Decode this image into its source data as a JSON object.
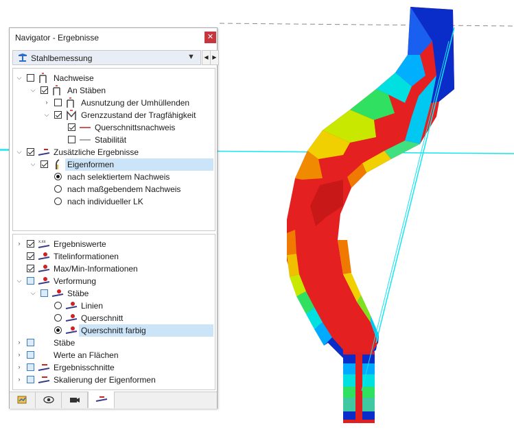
{
  "panel": {
    "title": "Navigator - Ergebnisse",
    "close_icon": "close-icon",
    "combo_value": "Stahlbemessung",
    "combo_icon": "steel-design-icon"
  },
  "tree_top": [
    {
      "label": "Nachweise",
      "checked": false,
      "expanded": true,
      "icon": "design-check-icon"
    },
    {
      "label": "An Stäben",
      "checked": true,
      "expanded": true,
      "icon": "design-check-icon"
    },
    {
      "label": "Ausnutzung der Umhüllenden",
      "checked": false,
      "expanded": false,
      "icon": "design-check-icon"
    },
    {
      "label": "Grenzzustand der Tragfähigkeit",
      "checked": true,
      "expanded": true,
      "icon": "ultimate-limit-state-icon"
    },
    {
      "label": "Querschnittsnachweis",
      "checked": true,
      "icon": "red-line-icon"
    },
    {
      "label": "Stabilität",
      "checked": false,
      "icon": "gray-line-icon"
    },
    {
      "label": "Zusätzliche Ergebnisse",
      "checked": true,
      "expanded": true,
      "icon": "additional-results-icon"
    },
    {
      "label": "Eigenformen",
      "checked": true,
      "expanded": true,
      "icon": "mode-shape-icon",
      "selected": true
    },
    {
      "label": "nach selektiertem Nachweis",
      "radio": true,
      "on": true
    },
    {
      "label": "nach maßgebendem Nachweis",
      "radio": true,
      "on": false
    },
    {
      "label": "nach individueller LK",
      "radio": true,
      "on": false
    }
  ],
  "tree_bottom": [
    {
      "label": "Ergebniswerte",
      "checked": true,
      "expanded": false,
      "icon": "result-values-icon"
    },
    {
      "label": "Titelinformationen",
      "checked": true,
      "icon": "title-info-icon"
    },
    {
      "label": "Max/Min-Informationen",
      "checked": true,
      "icon": "maxmin-info-icon"
    },
    {
      "label": "Verformung",
      "checked": false,
      "expanded": true,
      "icon": "deformation-icon",
      "blue": true
    },
    {
      "label": "Stäbe",
      "checked": false,
      "expanded": true,
      "icon": "members-icon",
      "blue": true
    },
    {
      "label": "Linien",
      "radio": true,
      "on": false,
      "icon": "members-icon"
    },
    {
      "label": "Querschnitt",
      "radio": true,
      "on": false,
      "icon": "members-icon"
    },
    {
      "label": "Querschnitt farbig",
      "radio": true,
      "on": true,
      "icon": "members-icon",
      "selected": true
    },
    {
      "label": "Stäbe",
      "checked": false,
      "expanded": false,
      "blue": true
    },
    {
      "label": "Werte an Flächen",
      "checked": false,
      "expanded": false,
      "blue": true
    },
    {
      "label": "Ergebnisschnitte",
      "checked": false,
      "expanded": false,
      "icon": "result-sections-icon",
      "blue": true
    },
    {
      "label": "Skalierung der Eigenformen",
      "checked": false,
      "expanded": false,
      "icon": "scaling-icon",
      "blue": true
    }
  ],
  "tabs": [
    {
      "icon": "data-icon"
    },
    {
      "icon": "eye-icon"
    },
    {
      "icon": "camera-icon"
    },
    {
      "icon": "results-icon",
      "active": true
    }
  ],
  "colors": {
    "selection": "#cce4f7",
    "guide_line": "#00e5ee",
    "dashed_line": "#7a7a7a",
    "close": "#c7363e"
  }
}
